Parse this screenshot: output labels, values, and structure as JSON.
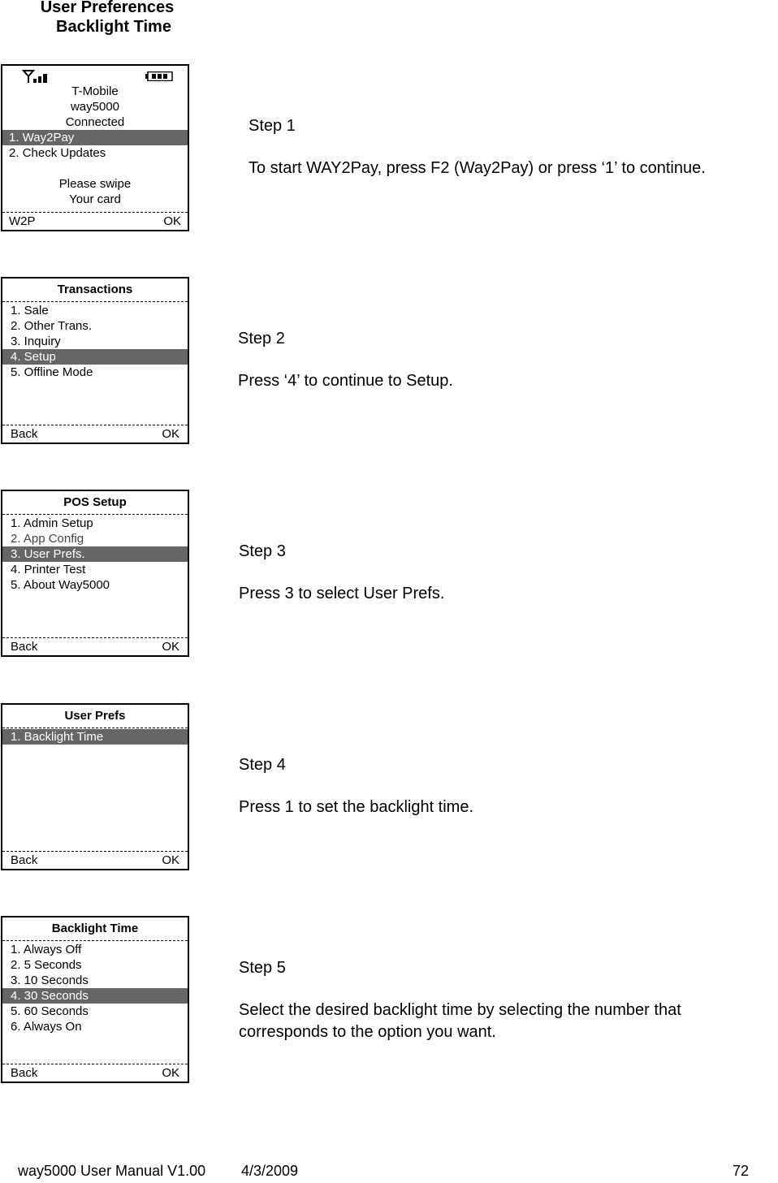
{
  "page_title": {
    "line1": "User Preferences",
    "line2": "Backlight Time"
  },
  "screens": {
    "home": {
      "carrier": "T-Mobile",
      "device": "way5000",
      "status": "Connected",
      "items": [
        {
          "label": "1. Way2Pay",
          "selected": true
        },
        {
          "label": "2. Check Updates",
          "selected": false
        }
      ],
      "prompt_line1": "Please swipe",
      "prompt_line2": "Your card",
      "softkey_left": "W2P",
      "softkey_right": "OK",
      "icons": [
        "signal-icon",
        "battery-icon"
      ]
    },
    "transactions": {
      "title": "Transactions",
      "items": [
        {
          "label": "1. Sale",
          "selected": false
        },
        {
          "label": "2. Other Trans.",
          "selected": false
        },
        {
          "label": "3. Inquiry",
          "selected": false
        },
        {
          "label": "4. Setup",
          "selected": true
        },
        {
          "label": "5. Offline Mode",
          "selected": false
        }
      ],
      "softkey_left": "Back",
      "softkey_right": "OK"
    },
    "pos_setup": {
      "title": "POS Setup",
      "items": [
        {
          "label": "1. Admin Setup",
          "selected": false
        },
        {
          "label": "2. App Config",
          "selected": false
        },
        {
          "label": "3. User Prefs.",
          "selected": true
        },
        {
          "label": "4. Printer Test",
          "selected": false
        },
        {
          "label": "5. About Way5000",
          "selected": false
        }
      ],
      "softkey_left": "Back",
      "softkey_right": "OK"
    },
    "user_prefs": {
      "title": "User Prefs",
      "items": [
        {
          "label": "1. Backlight Time",
          "selected": true
        }
      ],
      "softkey_left": "Back",
      "softkey_right": "OK"
    },
    "backlight_time": {
      "title": "Backlight Time",
      "items": [
        {
          "label": "1. Always Off",
          "selected": false
        },
        {
          "label": "2. 5 Seconds",
          "selected": false
        },
        {
          "label": "3. 10 Seconds",
          "selected": false
        },
        {
          "label": "4. 30 Seconds",
          "selected": true
        },
        {
          "label": "5. 60 Seconds",
          "selected": false
        },
        {
          "label": "6. Always On",
          "selected": false
        }
      ],
      "softkey_left": "Back",
      "softkey_right": "OK"
    }
  },
  "steps": [
    {
      "label": "Step 1",
      "text": "To start WAY2Pay, press F2 (Way2Pay) or press ‘1’ to continue."
    },
    {
      "label": "Step 2",
      "text": "Press ‘4’ to continue to Setup."
    },
    {
      "label": "Step 3",
      "text": "Press 3 to select User Prefs."
    },
    {
      "label": "Step 4",
      "text": "Press 1 to set the backlight time."
    },
    {
      "label": "Step 5",
      "text": "Select the desired backlight time by selecting the number that corresponds to the option you want."
    }
  ],
  "footer": {
    "manual": "way5000 User Manual V1.00",
    "date": "4/3/2009",
    "page": "72"
  },
  "colors": {
    "highlight": "#666666",
    "highlight_text": "#ffffff"
  }
}
